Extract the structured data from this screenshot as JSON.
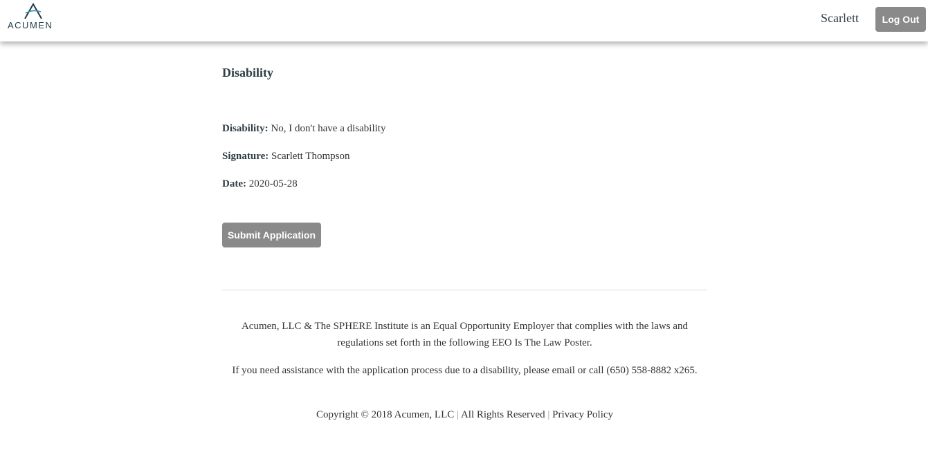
{
  "header": {
    "logo_text": "ACUMEN",
    "user_name": "Scarlett",
    "logout_label": "Log Out"
  },
  "form": {
    "title": "Disability",
    "fields": [
      {
        "label": "Disability:",
        "value": "No, I don't have a disability"
      },
      {
        "label": "Signature:",
        "value": "Scarlett Thompson"
      },
      {
        "label": "Date:",
        "value": "2020-05-28"
      }
    ],
    "submit_label": "Submit Application"
  },
  "footer": {
    "eeo_text": "Acumen, LLC & The SPHERE Institute is an Equal Opportunity Employer that complies with the laws and regulations set forth in the following EEO Is The Law Poster.",
    "assistance_text": "If you need assistance with the application process due to a disability, please email or call (650) 558-8882 x265.",
    "copyright": "Copyright © 2018 Acumen, LLC",
    "separator": "|",
    "rights": "All Rights Reserved",
    "privacy_label": "Privacy Policy"
  },
  "colors": {
    "brand": "#1d3a47",
    "button_bg": "#8a8a8a"
  }
}
